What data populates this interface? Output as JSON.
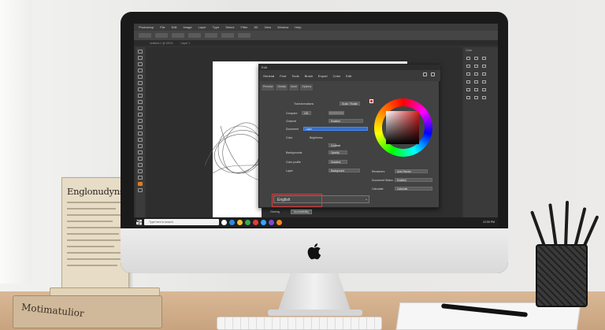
{
  "screen": {
    "menubar": [
      "Photoshop",
      "File",
      "Edit",
      "Image",
      "Layer",
      "Type",
      "Select",
      "Filter",
      "3D",
      "View",
      "Window",
      "Help"
    ],
    "doc_tabs": [
      "Untitled-1 @ 100%",
      "Layer 1"
    ],
    "right_panel_title": "Color"
  },
  "dialog": {
    "title": "Edit",
    "tabs": [
      "General",
      "Font",
      "Tools",
      "Brush",
      "Export",
      "Color",
      "Edit"
    ],
    "subtabs": [
      "Preview",
      "Details",
      "More",
      "Options"
    ],
    "rows": [
      {
        "label": "Transformations",
        "value": "Scale / Rotate"
      },
      {
        "label": "Compare",
        "value": "100"
      },
      {
        "label": "Channel",
        "value": "Enabled"
      },
      {
        "label": "Document",
        "value": "Layer"
      },
      {
        "label": "Color",
        "value": "Document Standard"
      },
      {
        "label": "Brightness",
        "value": "Contrast"
      },
      {
        "label": "Backgrounds",
        "value": "Opacity"
      },
      {
        "label": "Color profile",
        "value": "Gradient"
      },
      {
        "label": "Layer",
        "value": "Background"
      }
    ],
    "right_fields": [
      {
        "label": "Renderers",
        "value": "Auto Render"
      },
      {
        "label": "Document Status",
        "value": "Enabled"
      },
      {
        "label": "Calculate",
        "value": "Calculate"
      }
    ],
    "language_value": "English",
    "bottom_label": "Cloning",
    "bottom_button": "Accessibility"
  },
  "taskbar": {
    "search_placeholder": "Type here to search",
    "clock": "12:00 PM"
  },
  "props": {
    "book_spine_title": "Englonudyns",
    "book_flat_title": "Motimatulior"
  },
  "colors": {
    "accent_red": "#e23a3a",
    "swatch": "#d12222",
    "selection_blue": "#2f6fd4"
  }
}
